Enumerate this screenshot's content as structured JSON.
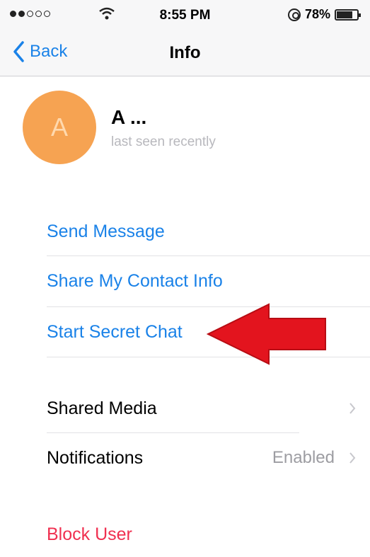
{
  "status_bar": {
    "time": "8:55 PM",
    "battery": "78%",
    "battery_level": 0.78
  },
  "nav": {
    "back_label": "Back",
    "title": "Info"
  },
  "profile": {
    "avatar_initial": "A",
    "name": "A ...",
    "status": "last seen recently",
    "avatar_color": "#f6a352"
  },
  "actions": {
    "send_message": "Send Message",
    "share_contact": "Share My Contact Info",
    "start_secret_chat": "Start Secret Chat"
  },
  "settings": {
    "shared_media": "Shared Media",
    "notifications": "Notifications",
    "notifications_value": "Enabled"
  },
  "danger": {
    "block_user": "Block User"
  },
  "colors": {
    "accent": "#1a82e8",
    "danger": "#f03050",
    "annotation_arrow": "#e3141e"
  },
  "icons": [
    "chevron-left-icon",
    "wifi-icon",
    "lock-rotation-icon",
    "battery-icon",
    "chevron-right-icon",
    "red-arrow-annotation"
  ]
}
